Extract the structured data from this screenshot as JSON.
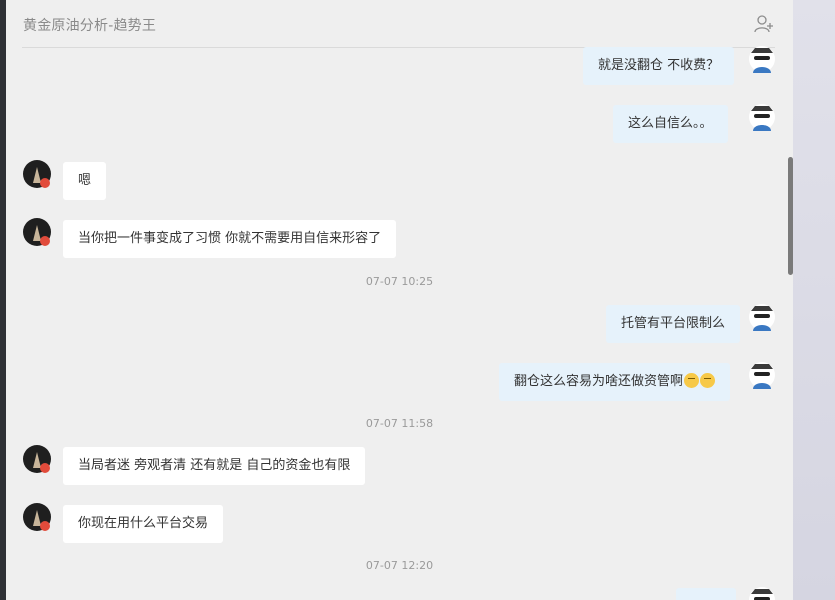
{
  "chat": {
    "title": "黄金原油分析-趋势王",
    "timestamps": [
      "07-07 10:25",
      "07-07 11:58",
      "07-07 12:20"
    ],
    "messages": [
      "就是没翻仓 不收费？",
      "这么自信么。。",
      "嗯",
      "当你把一件事变成了习惯 你就不需要用自信来形容了",
      "托管有平台限制么",
      "翻仓这么容易为啥还做资管啊",
      "当局者迷 旁观者清 还有就是 自己的资金也有限",
      "你现在用什么平台交易"
    ]
  },
  "icons": {
    "add_member": "add-member-icon",
    "emoji": "grinning-sweat-emoji",
    "sender_badge": "red-badge"
  }
}
